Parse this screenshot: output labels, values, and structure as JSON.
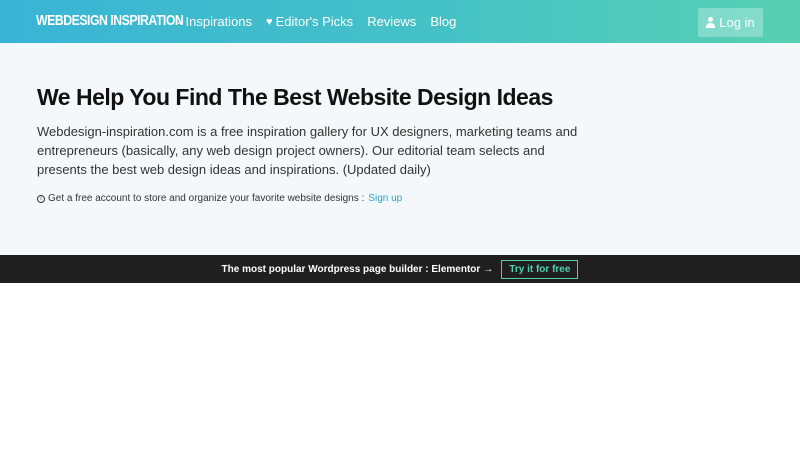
{
  "header": {
    "logo": "WEBDESIGN INSPIRATION",
    "nav": [
      {
        "icon": "chevron-down-icon",
        "label": "Inspirations"
      },
      {
        "icon": "heart-icon",
        "label": "Editor's Picks"
      },
      {
        "icon": "",
        "label": "Reviews"
      },
      {
        "icon": "",
        "label": "Blog"
      }
    ],
    "login_label": "Log in"
  },
  "hero": {
    "title": "We Help You Find The Best Website Design Ideas",
    "description": "Webdesign-inspiration.com is a free inspiration gallery for UX designers, marketing teams and entrepreneurs (basically, any web design project owners). Our editorial team selects and presents the best web design ideas and inspirations. (Updated daily)",
    "note": "Get a free account to store and organize your favorite website designs :",
    "signup_label": "Sign up"
  },
  "banner": {
    "text": "The most popular Wordpress page builder : Elementor",
    "arrow": "→",
    "button_label": "Try it for free"
  },
  "colors": {
    "header_gradient_start": "#39b4d6",
    "header_gradient_end": "#57d0b2",
    "hero_bg": "#f4f8fa",
    "banner_bg": "#1f1f1f",
    "accent": "#4fd1b0",
    "link": "#29a8c7"
  }
}
